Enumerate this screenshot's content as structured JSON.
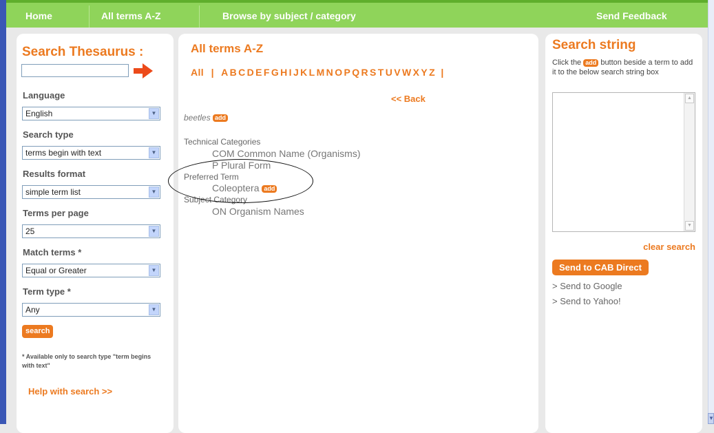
{
  "nav": {
    "home": "Home",
    "all_terms": "All terms A-Z",
    "browse": "Browse by subject / category",
    "feedback": "Send Feedback"
  },
  "left": {
    "title": "Search Thesaurus :",
    "search_value": "",
    "language_label": "Language",
    "language_value": "English",
    "search_type_label": "Search type",
    "search_type_value": "terms begin with text",
    "results_format_label": "Results format",
    "results_format_value": "simple term list",
    "terms_per_page_label": "Terms per page",
    "terms_per_page_value": "25",
    "match_terms_label": "Match terms *",
    "match_terms_value": "Equal or Greater",
    "term_type_label": "Term type *",
    "term_type_value": "Any",
    "search_button": "search",
    "note": "* Available only to search type \"term begins with text\"",
    "help": "Help with search >>"
  },
  "middle": {
    "title": "All terms A-Z",
    "all": "All",
    "letters": [
      "A",
      "B",
      "C",
      "D",
      "E",
      "F",
      "G",
      "H",
      "I",
      "J",
      "K",
      "L",
      "M",
      "N",
      "O",
      "P",
      "Q",
      "R",
      "S",
      "T",
      "U",
      "V",
      "W",
      "X",
      "Y",
      "Z"
    ],
    "back": "<< Back",
    "term": "beetles",
    "add": "add",
    "tech_cat_label": "Technical Categories",
    "tech_cat_1": "COM Common Name (Organisms)",
    "tech_cat_2": "P Plural Form",
    "preferred_label": "Preferred Term",
    "preferred_value": "Coleoptera",
    "subject_label": "Subject Category",
    "subject_value": "ON Organism Names"
  },
  "right": {
    "title": "Search string",
    "instr_before": "Click the ",
    "instr_after": " button beside a term to add it to the below search string box",
    "add": "add",
    "search_string_value": "",
    "clear": "clear search",
    "cab_button": "Send to CAB Direct",
    "google": "> Send to Google",
    "yahoo": "> Send to Yahoo!"
  },
  "colors": {
    "accent": "#ec7a20",
    "nav_bg": "#8fd45a"
  }
}
